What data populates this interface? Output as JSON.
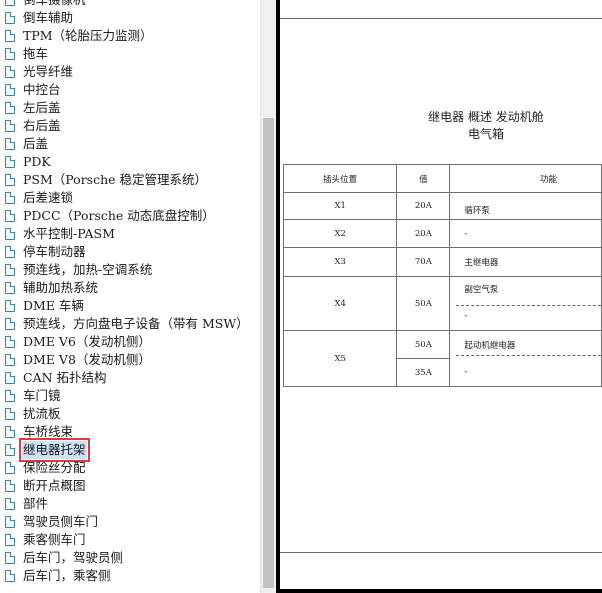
{
  "tree": {
    "items": [
      {
        "label": "倒车摄像机"
      },
      {
        "label": "倒车辅助"
      },
      {
        "label": "TPM（轮胎压力监测）"
      },
      {
        "label": "拖车"
      },
      {
        "label": "光导纤维"
      },
      {
        "label": "中控台"
      },
      {
        "label": "左后盖"
      },
      {
        "label": "右后盖"
      },
      {
        "label": "后盖"
      },
      {
        "label": "PDK"
      },
      {
        "label": "PSM（Porsche 稳定管理系统）"
      },
      {
        "label": "后差速锁"
      },
      {
        "label": "PDCC（Porsche 动态底盘控制）"
      },
      {
        "label": "水平控制-PASM"
      },
      {
        "label": "停车制动器"
      },
      {
        "label": "预连线，加热-空调系统"
      },
      {
        "label": "辅助加热系统"
      },
      {
        "label": "DME 车辆"
      },
      {
        "label": "预连线，方向盘电子设备（带有 MSW）"
      },
      {
        "label": "DME V6（发动机侧）"
      },
      {
        "label": "DME V8（发动机侧）"
      },
      {
        "label": "CAN 拓扑结构"
      },
      {
        "label": "车门镜"
      },
      {
        "label": "扰流板"
      },
      {
        "label": "车桥线束"
      },
      {
        "label": "继电器托架",
        "selected": true
      },
      {
        "label": "保险丝分配"
      },
      {
        "label": "断开点概图"
      },
      {
        "label": "部件"
      },
      {
        "label": "驾驶员侧车门"
      },
      {
        "label": "乘客侧车门"
      },
      {
        "label": "后车门，驾驶员侧"
      },
      {
        "label": "后车门，乘客侧"
      }
    ]
  },
  "document": {
    "title_line1": "继电器 概述 发动机舱",
    "title_line2": "电气箱",
    "headers": {
      "position": "插头位置",
      "value": "值",
      "function": "功能"
    },
    "rows": {
      "x1": {
        "position": "X1",
        "value": "20A",
        "function": "循环泵"
      },
      "x2": {
        "position": "X2",
        "value": "20A",
        "function": "-"
      },
      "x3": {
        "position": "X3",
        "value": "70A",
        "function": "主继电器"
      },
      "x4": {
        "position": "X4",
        "value": "50A",
        "function_a": "副空气泵",
        "function_b": "-"
      },
      "x5": {
        "position": "X5",
        "value_a": "50A",
        "value_b": "35A",
        "function_a": "起动机继电器",
        "function_b": "-"
      }
    }
  }
}
